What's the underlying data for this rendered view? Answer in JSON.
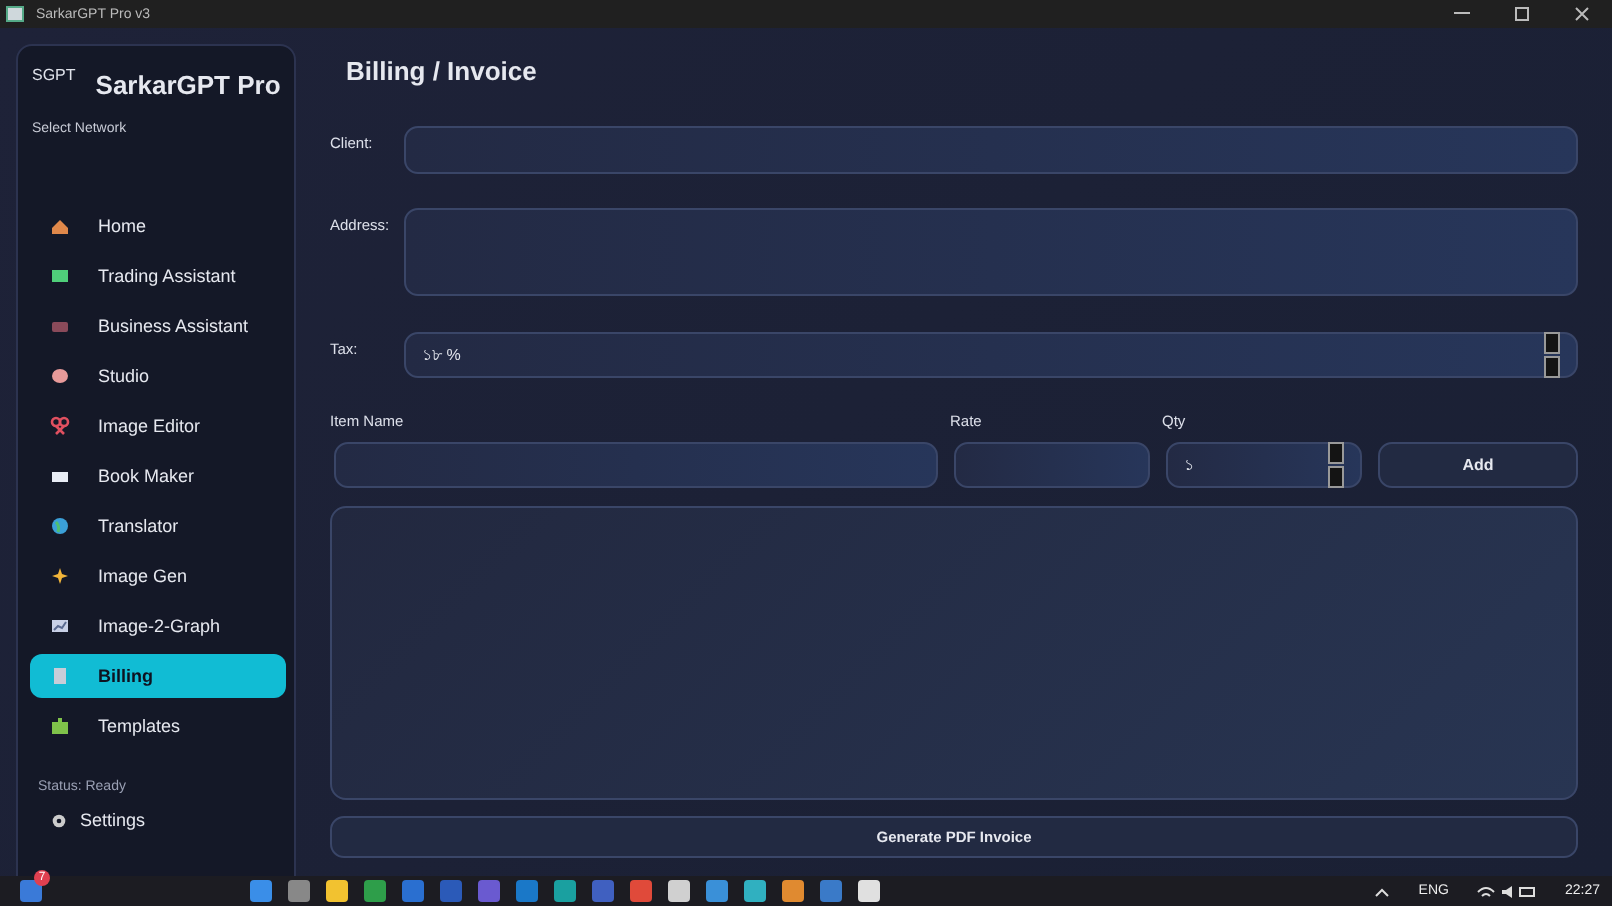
{
  "window": {
    "title": "SarkarGPT Pro v3"
  },
  "sidebar": {
    "badge": "SGPT",
    "brand": "SarkarGPT Pro",
    "network_label": "Select Network",
    "items": [
      {
        "label": "Home",
        "selected": false
      },
      {
        "label": "Trading Assistant",
        "selected": false
      },
      {
        "label": "Business Assistant",
        "selected": false
      },
      {
        "label": "Studio",
        "selected": false
      },
      {
        "label": "Image Editor",
        "selected": false
      },
      {
        "label": "Book Maker",
        "selected": false
      },
      {
        "label": "Translator",
        "selected": false
      },
      {
        "label": "Image Gen",
        "selected": false
      },
      {
        "label": "Image-2-Graph",
        "selected": false
      },
      {
        "label": "Billing",
        "selected": true
      },
      {
        "label": "Templates",
        "selected": false
      }
    ],
    "status": "Status: Ready",
    "settings": "Settings"
  },
  "page": {
    "title": "Billing / Invoice",
    "client_label": "Client:",
    "address_label": "Address:",
    "tax_label": "Tax:",
    "tax_value": "১৮ %",
    "item_name_label": "Item Name",
    "rate_label": "Rate",
    "qty_label": "Qty",
    "qty_value": "১",
    "add_button": "Add",
    "generate_button": "Generate PDF Invoice"
  },
  "taskbar": {
    "notification_count": "7",
    "language": "ENG",
    "time": "22:27"
  }
}
